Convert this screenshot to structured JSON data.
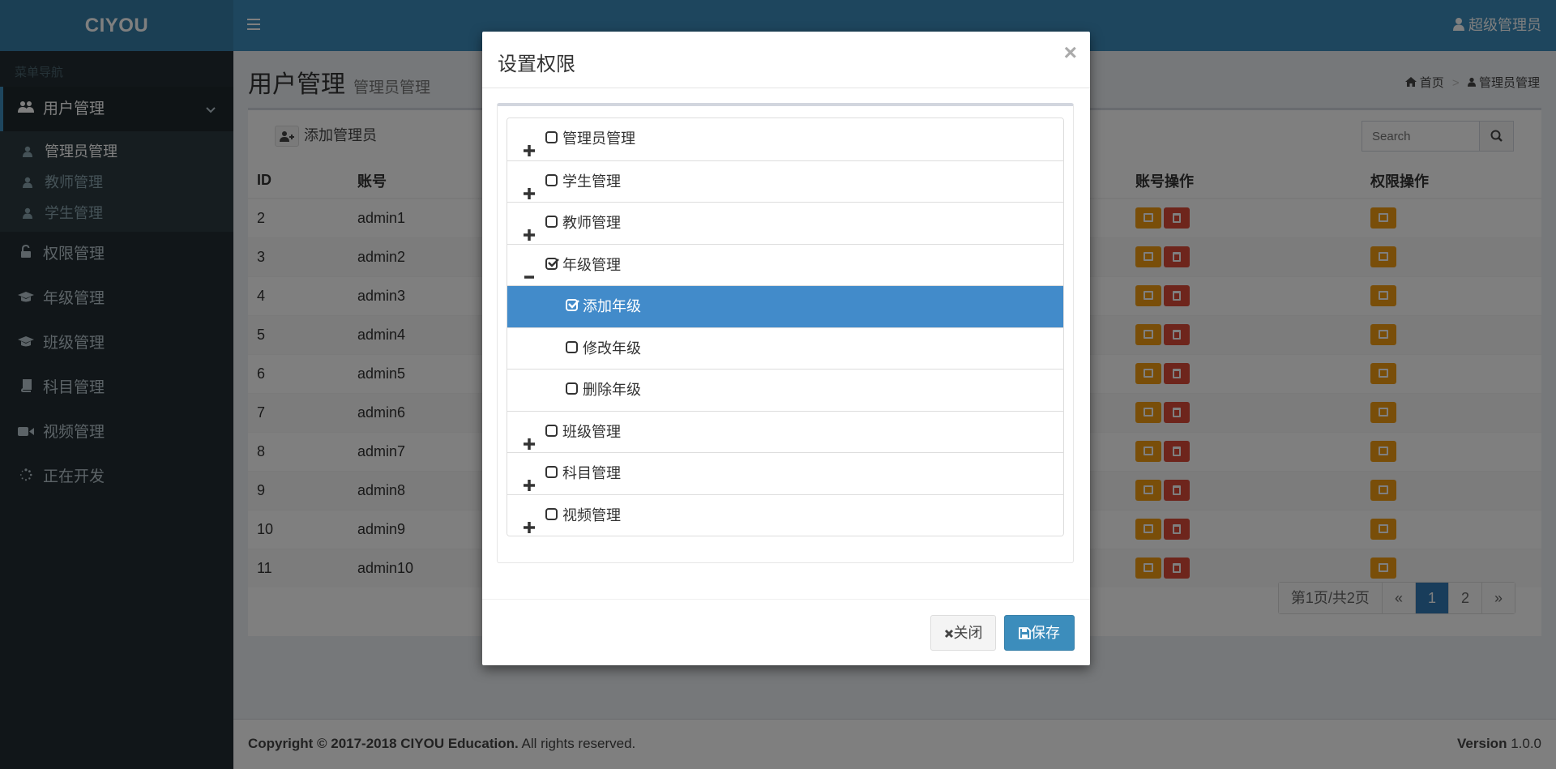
{
  "header": {
    "logo": "CIYOU",
    "user": "超级管理员"
  },
  "sidebar": {
    "header": "菜单导航",
    "items": [
      {
        "label": "用户管理",
        "icon": "users-icon",
        "active": true
      },
      {
        "label": "权限管理",
        "icon": "unlock-icon"
      },
      {
        "label": "年级管理",
        "icon": "graduation-cap-icon"
      },
      {
        "label": "班级管理",
        "icon": "graduation-cap-icon"
      },
      {
        "label": "科目管理",
        "icon": "book-icon"
      },
      {
        "label": "视频管理",
        "icon": "video-camera-icon"
      },
      {
        "label": "正在开发",
        "icon": "spinner-icon"
      }
    ],
    "subitems": [
      {
        "label": "管理员管理",
        "current": true
      },
      {
        "label": "教师管理"
      },
      {
        "label": "学生管理"
      }
    ]
  },
  "page": {
    "title": "用户管理",
    "subtitle": "管理员管理",
    "breadcrumb_home": "首页",
    "breadcrumb_current": "管理员管理"
  },
  "toolbar": {
    "add_label": "添加管理员",
    "search_placeholder": "Search"
  },
  "table": {
    "headers": [
      "ID",
      "账号",
      "账号操作",
      "权限操作"
    ],
    "rows": [
      {
        "id": "2",
        "account": "admin1"
      },
      {
        "id": "3",
        "account": "admin2"
      },
      {
        "id": "4",
        "account": "admin3"
      },
      {
        "id": "5",
        "account": "admin4"
      },
      {
        "id": "6",
        "account": "admin5"
      },
      {
        "id": "7",
        "account": "admin6"
      },
      {
        "id": "8",
        "account": "admin7"
      },
      {
        "id": "9",
        "account": "admin8"
      },
      {
        "id": "10",
        "account": "admin9"
      },
      {
        "id": "11",
        "account": "admin10"
      }
    ]
  },
  "pagination": {
    "info": "第1页/共2页",
    "prev": "«",
    "pages": [
      "1",
      "2"
    ],
    "current": "1",
    "next": "»"
  },
  "footer": {
    "copyright_bold": "Copyright © 2017-2018 CIYOU Education.",
    "copyright_rest": " All rights reserved.",
    "version_label": "Version",
    "version": "1.0.0"
  },
  "modal": {
    "title": "设置权限",
    "close_symbol": "×",
    "tree": [
      {
        "label": "管理员管理",
        "level": 0,
        "expander": "plus",
        "checked": false
      },
      {
        "label": "学生管理",
        "level": 0,
        "expander": "plus",
        "checked": false
      },
      {
        "label": "教师管理",
        "level": 0,
        "expander": "plus",
        "checked": false
      },
      {
        "label": "年级管理",
        "level": 0,
        "expander": "minus",
        "checked": true
      },
      {
        "label": "添加年级",
        "level": 1,
        "expander": "none",
        "checked": true,
        "selected": true
      },
      {
        "label": "修改年级",
        "level": 1,
        "expander": "none",
        "checked": false
      },
      {
        "label": "删除年级",
        "level": 1,
        "expander": "none",
        "checked": false
      },
      {
        "label": "班级管理",
        "level": 0,
        "expander": "plus",
        "checked": false
      },
      {
        "label": "科目管理",
        "level": 0,
        "expander": "plus",
        "checked": false
      },
      {
        "label": "视频管理",
        "level": 0,
        "expander": "plus",
        "checked": false
      }
    ],
    "close_button": "关闭",
    "save_button": "保存"
  },
  "colors": {
    "primary": "#3c8dbc",
    "sidebar": "#222d32",
    "warning": "#f39c12",
    "danger": "#dd4b39",
    "tree_selected": "#428bca"
  }
}
